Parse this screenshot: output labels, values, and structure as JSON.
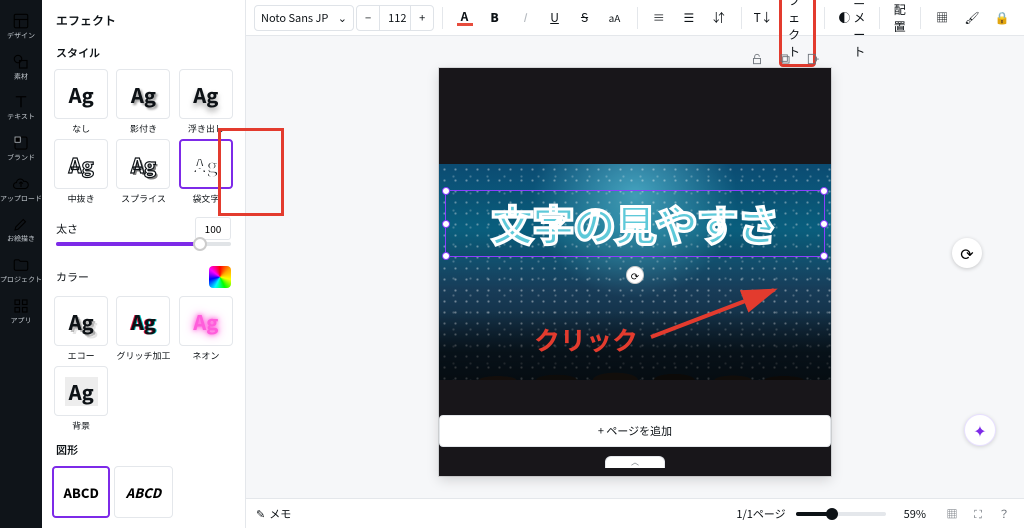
{
  "rail": {
    "items": [
      {
        "label": "デザイン"
      },
      {
        "label": "素材"
      },
      {
        "label": "テキスト"
      },
      {
        "label": "ブランド"
      },
      {
        "label": "アップロード"
      },
      {
        "label": "お絵描き"
      },
      {
        "label": "プロジェクト"
      },
      {
        "label": "アプリ"
      }
    ]
  },
  "panel": {
    "title": "エフェクト",
    "style_section": "スタイル",
    "tiles": [
      {
        "sample": "Ag",
        "label": "なし"
      },
      {
        "sample": "Ag",
        "label": "影付き"
      },
      {
        "sample": "Ag",
        "label": "浮き出し"
      },
      {
        "sample": "Ag",
        "label": "中抜き"
      },
      {
        "sample": "Ag",
        "label": "スプライス"
      },
      {
        "sample": "Ag",
        "label": "袋文字"
      },
      {
        "sample": "Ag",
        "label": "エコー"
      },
      {
        "sample": "Ag",
        "label": "グリッチ加工"
      },
      {
        "sample": "Ag",
        "label": "ネオン"
      },
      {
        "sample": "Ag",
        "label": "背景"
      }
    ],
    "thickness_label": "太さ",
    "thickness_value": "100",
    "color_label": "カラー",
    "shape_section": "図形",
    "shapes": [
      {
        "sample": "ABCD"
      },
      {
        "sample": "ABCD"
      }
    ]
  },
  "toolbar": {
    "font": "Noto Sans JP",
    "size": "112",
    "effect": "エフェクト",
    "animate": "アニメート",
    "position": "配置"
  },
  "canvas": {
    "text_content": "文字の見やすさ",
    "add_page": "+ ページを追加"
  },
  "annotation": {
    "text": "クリック"
  },
  "footer": {
    "notes": "メモ",
    "pages": "1/1ページ",
    "zoom": "59%"
  },
  "colors": {
    "accent": "#7d2ae8",
    "highlight": "#e33b2e"
  }
}
